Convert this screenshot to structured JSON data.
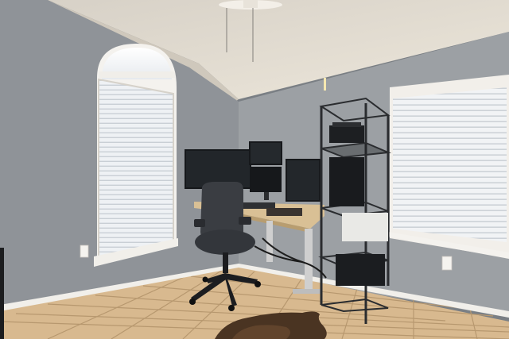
{
  "scene": {
    "palette": {
      "wall_left": "#8d9095",
      "wall_right": "#9a9ea2",
      "ceiling": "#dcd6cc",
      "floor_tile": "#d9b98f",
      "grout": "#b89a72",
      "baseboard": "#f2f0ec",
      "window_light": "#f4f6f8",
      "blind": "#e9ecef",
      "desk_top": "#d8bf94",
      "monitor": "#16181b",
      "chair": "#3a3d42",
      "shelf_metal": "#2a2c2f",
      "rug": "#4a3422"
    },
    "icons": [
      "ceiling-fan-icon",
      "arched-window-icon",
      "window-blinds-icon",
      "monitor-icon",
      "office-chair-icon",
      "standing-desk-icon",
      "wire-shelf-icon",
      "printer-icon",
      "electrical-outlet-icon",
      "cowhide-rug-icon"
    ]
  }
}
